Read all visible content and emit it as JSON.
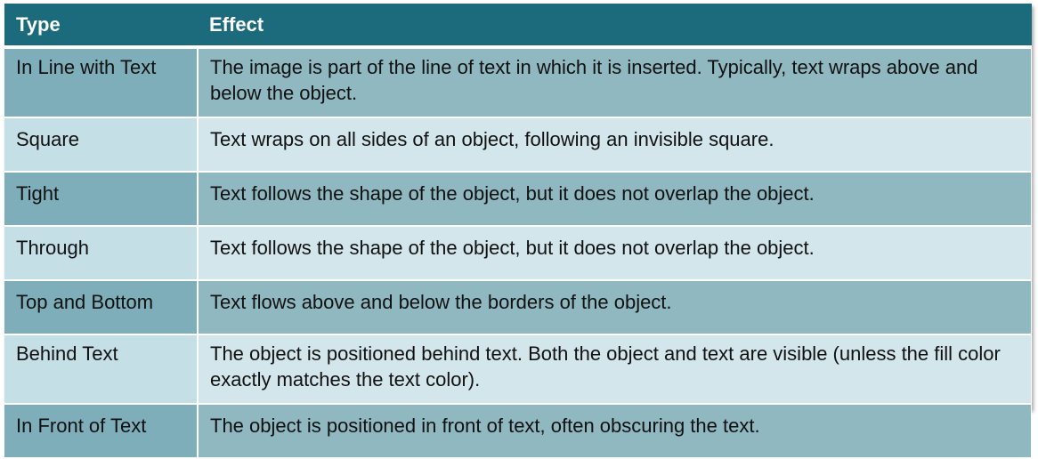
{
  "table": {
    "headers": {
      "type": "Type",
      "effect": "Effect"
    },
    "rows": [
      {
        "type": "In Line with Text",
        "effect": "The image is part of the line of text in which it is inserted. Typically, text wraps above and below the object."
      },
      {
        "type": "Square",
        "effect": "Text wraps on all sides of an object, following an invisible square."
      },
      {
        "type": "Tight",
        "effect": "Text follows the shape of the object, but it does not overlap the object."
      },
      {
        "type": "Through",
        "effect": "Text follows the shape of the object, but it does not overlap the object."
      },
      {
        "type": "Top and Bottom",
        "effect": "Text flows above and below the borders of the object."
      },
      {
        "type": "Behind Text",
        "effect": "The object is positioned behind text. Both the object and text are visible (unless the fill color exactly matches the text color)."
      },
      {
        "type": "In Front of Text",
        "effect": "The object is positioned in front of text, often obscuring the text."
      }
    ]
  },
  "colors": {
    "header_bg": "#1b6b7c",
    "row_dark": "#8fb8c1",
    "row_light": "#d3e6ec"
  }
}
